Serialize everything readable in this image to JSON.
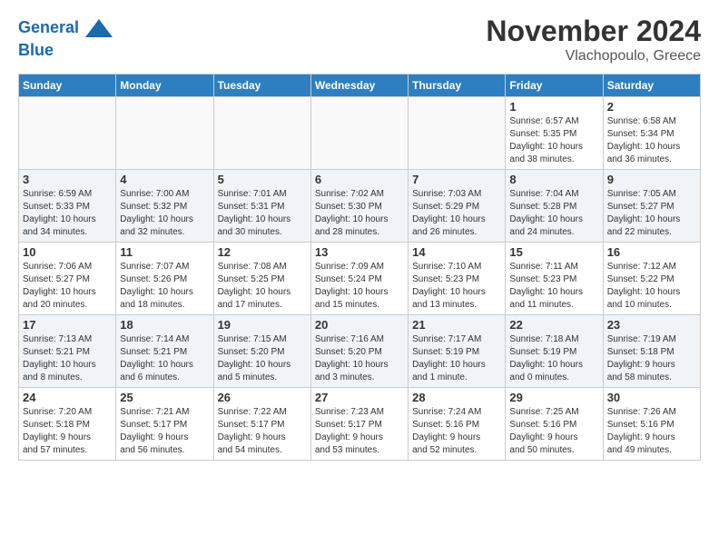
{
  "header": {
    "logo_line1": "General",
    "logo_line2": "Blue",
    "month_title": "November 2024",
    "location": "Vlachopoulo, Greece"
  },
  "columns": [
    "Sunday",
    "Monday",
    "Tuesday",
    "Wednesday",
    "Thursday",
    "Friday",
    "Saturday"
  ],
  "weeks": [
    {
      "days": [
        {
          "num": "",
          "info": ""
        },
        {
          "num": "",
          "info": ""
        },
        {
          "num": "",
          "info": ""
        },
        {
          "num": "",
          "info": ""
        },
        {
          "num": "",
          "info": ""
        },
        {
          "num": "1",
          "info": "Sunrise: 6:57 AM\nSunset: 5:35 PM\nDaylight: 10 hours\nand 38 minutes."
        },
        {
          "num": "2",
          "info": "Sunrise: 6:58 AM\nSunset: 5:34 PM\nDaylight: 10 hours\nand 36 minutes."
        }
      ]
    },
    {
      "days": [
        {
          "num": "3",
          "info": "Sunrise: 6:59 AM\nSunset: 5:33 PM\nDaylight: 10 hours\nand 34 minutes."
        },
        {
          "num": "4",
          "info": "Sunrise: 7:00 AM\nSunset: 5:32 PM\nDaylight: 10 hours\nand 32 minutes."
        },
        {
          "num": "5",
          "info": "Sunrise: 7:01 AM\nSunset: 5:31 PM\nDaylight: 10 hours\nand 30 minutes."
        },
        {
          "num": "6",
          "info": "Sunrise: 7:02 AM\nSunset: 5:30 PM\nDaylight: 10 hours\nand 28 minutes."
        },
        {
          "num": "7",
          "info": "Sunrise: 7:03 AM\nSunset: 5:29 PM\nDaylight: 10 hours\nand 26 minutes."
        },
        {
          "num": "8",
          "info": "Sunrise: 7:04 AM\nSunset: 5:28 PM\nDaylight: 10 hours\nand 24 minutes."
        },
        {
          "num": "9",
          "info": "Sunrise: 7:05 AM\nSunset: 5:27 PM\nDaylight: 10 hours\nand 22 minutes."
        }
      ]
    },
    {
      "days": [
        {
          "num": "10",
          "info": "Sunrise: 7:06 AM\nSunset: 5:27 PM\nDaylight: 10 hours\nand 20 minutes."
        },
        {
          "num": "11",
          "info": "Sunrise: 7:07 AM\nSunset: 5:26 PM\nDaylight: 10 hours\nand 18 minutes."
        },
        {
          "num": "12",
          "info": "Sunrise: 7:08 AM\nSunset: 5:25 PM\nDaylight: 10 hours\nand 17 minutes."
        },
        {
          "num": "13",
          "info": "Sunrise: 7:09 AM\nSunset: 5:24 PM\nDaylight: 10 hours\nand 15 minutes."
        },
        {
          "num": "14",
          "info": "Sunrise: 7:10 AM\nSunset: 5:23 PM\nDaylight: 10 hours\nand 13 minutes."
        },
        {
          "num": "15",
          "info": "Sunrise: 7:11 AM\nSunset: 5:23 PM\nDaylight: 10 hours\nand 11 minutes."
        },
        {
          "num": "16",
          "info": "Sunrise: 7:12 AM\nSunset: 5:22 PM\nDaylight: 10 hours\nand 10 minutes."
        }
      ]
    },
    {
      "days": [
        {
          "num": "17",
          "info": "Sunrise: 7:13 AM\nSunset: 5:21 PM\nDaylight: 10 hours\nand 8 minutes."
        },
        {
          "num": "18",
          "info": "Sunrise: 7:14 AM\nSunset: 5:21 PM\nDaylight: 10 hours\nand 6 minutes."
        },
        {
          "num": "19",
          "info": "Sunrise: 7:15 AM\nSunset: 5:20 PM\nDaylight: 10 hours\nand 5 minutes."
        },
        {
          "num": "20",
          "info": "Sunrise: 7:16 AM\nSunset: 5:20 PM\nDaylight: 10 hours\nand 3 minutes."
        },
        {
          "num": "21",
          "info": "Sunrise: 7:17 AM\nSunset: 5:19 PM\nDaylight: 10 hours\nand 1 minute."
        },
        {
          "num": "22",
          "info": "Sunrise: 7:18 AM\nSunset: 5:19 PM\nDaylight: 10 hours\nand 0 minutes."
        },
        {
          "num": "23",
          "info": "Sunrise: 7:19 AM\nSunset: 5:18 PM\nDaylight: 9 hours\nand 58 minutes."
        }
      ]
    },
    {
      "days": [
        {
          "num": "24",
          "info": "Sunrise: 7:20 AM\nSunset: 5:18 PM\nDaylight: 9 hours\nand 57 minutes."
        },
        {
          "num": "25",
          "info": "Sunrise: 7:21 AM\nSunset: 5:17 PM\nDaylight: 9 hours\nand 56 minutes."
        },
        {
          "num": "26",
          "info": "Sunrise: 7:22 AM\nSunset: 5:17 PM\nDaylight: 9 hours\nand 54 minutes."
        },
        {
          "num": "27",
          "info": "Sunrise: 7:23 AM\nSunset: 5:17 PM\nDaylight: 9 hours\nand 53 minutes."
        },
        {
          "num": "28",
          "info": "Sunrise: 7:24 AM\nSunset: 5:16 PM\nDaylight: 9 hours\nand 52 minutes."
        },
        {
          "num": "29",
          "info": "Sunrise: 7:25 AM\nSunset: 5:16 PM\nDaylight: 9 hours\nand 50 minutes."
        },
        {
          "num": "30",
          "info": "Sunrise: 7:26 AM\nSunset: 5:16 PM\nDaylight: 9 hours\nand 49 minutes."
        }
      ]
    }
  ]
}
